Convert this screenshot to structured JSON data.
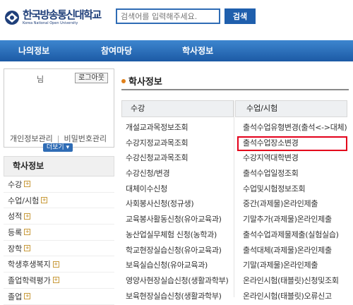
{
  "header": {
    "logo_text": "한국방송통신대학교",
    "logo_subtext": "Korea National Open University",
    "search_placeholder": "검색어를 입력해주세요.",
    "search_button": "검색"
  },
  "nav": {
    "myinfo": "나의정보",
    "participate": "참여마당",
    "academic": "학사정보"
  },
  "login": {
    "user_suffix": "님",
    "logout": "로그아웃",
    "account_settings": "개인정보관리",
    "change_password": "비밀번호관리",
    "more": "더보기"
  },
  "left_menu": {
    "title": "학사정보",
    "items": [
      "수강",
      "수업/시험",
      "성적",
      "등록",
      "장학",
      "학생후생복지",
      "졸업학력평가",
      "졸업"
    ]
  },
  "page_title": "학사정보",
  "columns": [
    {
      "heading": "수강",
      "items": [
        "개설교과목정보조회",
        "수강지정교과목조회",
        "수강신청교과목조회",
        "수강신청/변경",
        "대체이수신청",
        "사회봉사신청(정규생)",
        "교육봉사활동신청(유아교육과)",
        "농산업실무체험 신청(농학과)",
        "학교현장실습신청(유아교육과)",
        "보육실습신청(유아교육과)",
        "영양사현장실습신청(생활과학부)",
        "보육현장실습신청(생활과학부)"
      ]
    },
    {
      "heading": "수업/시험",
      "items": [
        "출석수업유형변경(출석<->대체)",
        "출석수업장소변경",
        "수강지역대학변경",
        "출석수업일정조회",
        "수업및시험정보조회",
        "중간(과제물)온라인제출",
        "기말추가(과제물)온라인제출",
        "출석수업과제물제출(실험실습)",
        "출석대체(과제물)온라인제출",
        "기말(과제물)온라인제출",
        "온라인시험(태블릿)신청및조회",
        "온라인시험(태블릿)오류신고"
      ]
    }
  ],
  "colors": {
    "nav": "#1c5aa5",
    "highlight": "#e3001b",
    "accent": "#e0801a"
  }
}
